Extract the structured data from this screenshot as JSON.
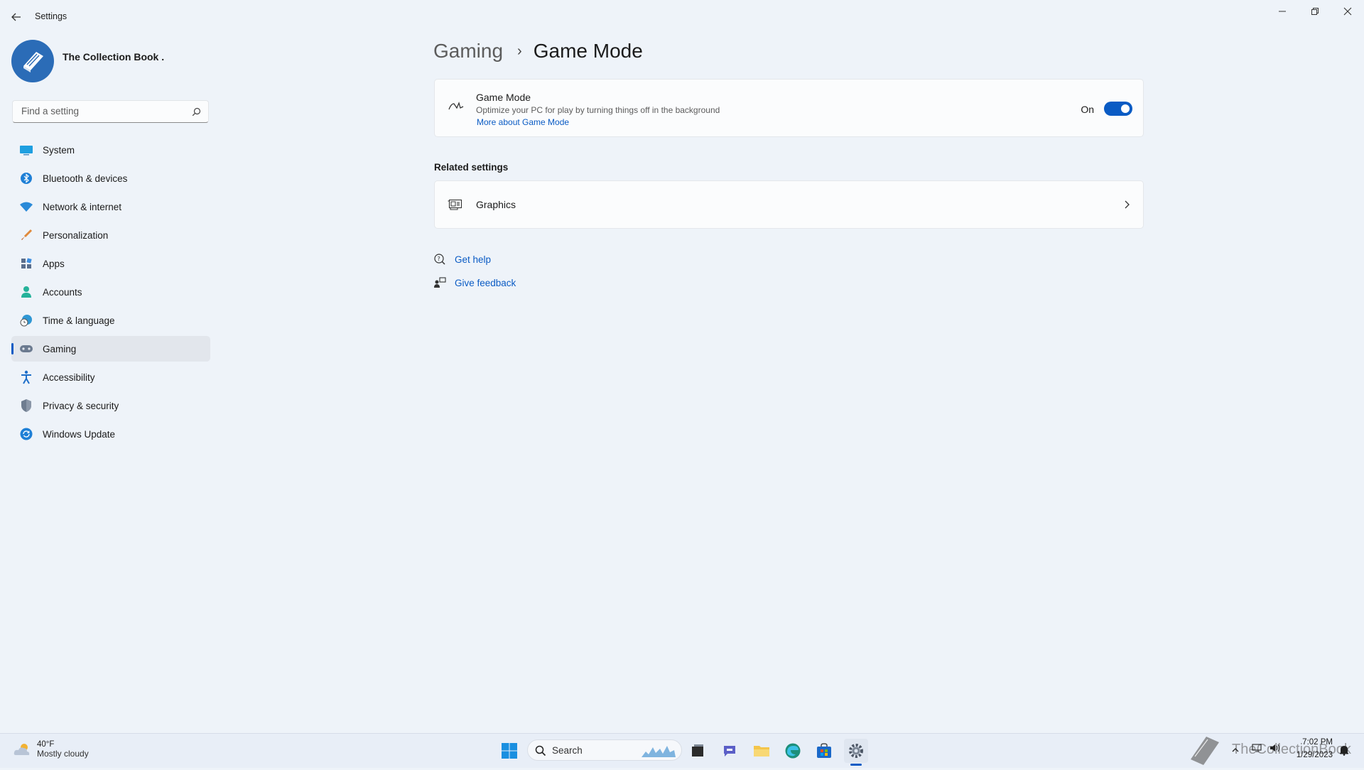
{
  "window": {
    "title": "Settings"
  },
  "profile": {
    "name": "The Collection Book ."
  },
  "search": {
    "placeholder": "Find a setting"
  },
  "sidebar": {
    "items": [
      {
        "label": "System",
        "icon": "system-icon"
      },
      {
        "label": "Bluetooth & devices",
        "icon": "bluetooth-icon"
      },
      {
        "label": "Network & internet",
        "icon": "wifi-icon"
      },
      {
        "label": "Personalization",
        "icon": "brush-icon"
      },
      {
        "label": "Apps",
        "icon": "apps-icon"
      },
      {
        "label": "Accounts",
        "icon": "person-icon"
      },
      {
        "label": "Time & language",
        "icon": "globe-clock-icon"
      },
      {
        "label": "Gaming",
        "icon": "controller-icon",
        "active": true
      },
      {
        "label": "Accessibility",
        "icon": "accessibility-icon"
      },
      {
        "label": "Privacy & security",
        "icon": "shield-icon"
      },
      {
        "label": "Windows Update",
        "icon": "update-icon"
      }
    ]
  },
  "breadcrumb": {
    "parent": "Gaming",
    "separator": "›",
    "current": "Game Mode"
  },
  "game_mode": {
    "title": "Game Mode",
    "description": "Optimize your PC for play by turning things off in the background",
    "link": "More about Game Mode",
    "toggle_state": "On",
    "enabled": true
  },
  "related": {
    "heading": "Related settings",
    "items": [
      {
        "label": "Graphics"
      }
    ]
  },
  "help": {
    "get_help": "Get help",
    "give_feedback": "Give feedback"
  },
  "taskbar": {
    "weather_temp": "40°F",
    "weather_desc": "Mostly cloudy",
    "search_label": "Search",
    "time": "7:02 PM",
    "date": "1/29/2023",
    "watermark": "TheCollectionBook"
  },
  "colors": {
    "accent": "#0a5bc4",
    "background": "#eef3f9",
    "card": "#fbfcfd"
  }
}
